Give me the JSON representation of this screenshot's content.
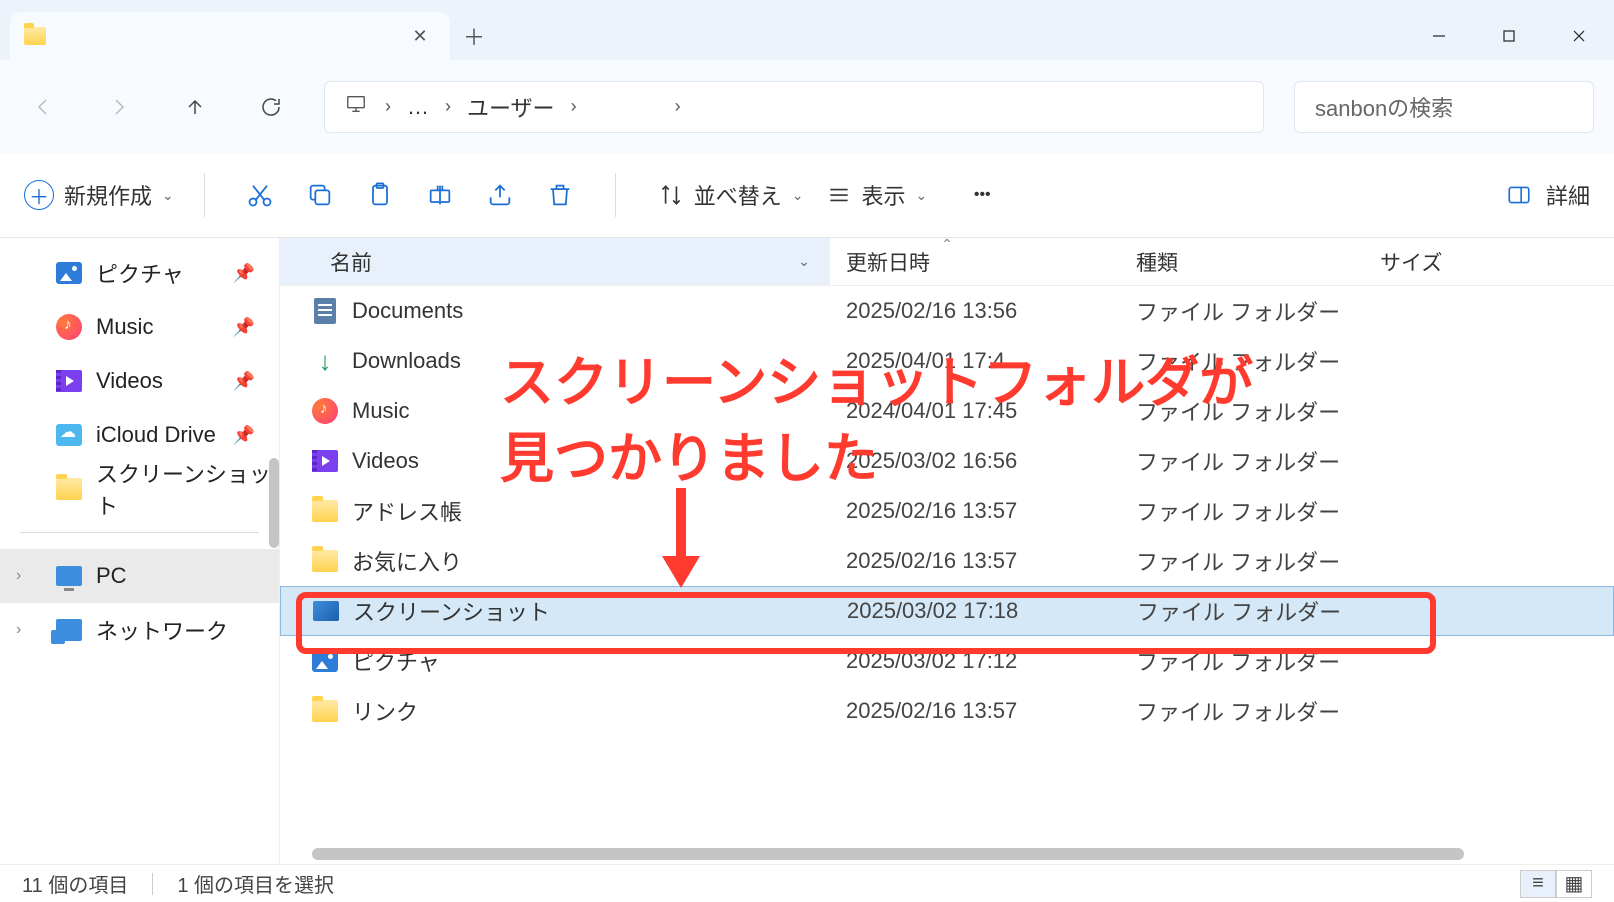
{
  "titlebar": {
    "tab_title": "　　　"
  },
  "nav": {
    "breadcrumb": {
      "dots": "…",
      "users": "ユーザー",
      "user_blurred": "　　　"
    },
    "search_placeholder": "sanbonの検索"
  },
  "toolbar": {
    "new": "新規作成",
    "sort": "並べ替え",
    "view": "表示",
    "details": "詳細"
  },
  "sidebar": {
    "items": [
      {
        "label": "ピクチャ",
        "icon": "picture",
        "pinned": true
      },
      {
        "label": "Music",
        "icon": "music",
        "pinned": true
      },
      {
        "label": "Videos",
        "icon": "video",
        "pinned": true
      },
      {
        "label": "iCloud Drive",
        "icon": "cloud",
        "pinned": true
      },
      {
        "label": "スクリーンショット",
        "icon": "folder",
        "pinned": false
      }
    ],
    "pc": "PC",
    "network": "ネットワーク"
  },
  "columns": {
    "name": "名前",
    "date": "更新日時",
    "type": "種類",
    "size": "サイズ"
  },
  "files": [
    {
      "name": "Documents",
      "date": "2025/02/16 13:56",
      "type": "ファイル フォルダー",
      "icon": "doc"
    },
    {
      "name": "Downloads",
      "date": "2025/04/01 17:4",
      "type": "ファイル フォルダー",
      "icon": "download"
    },
    {
      "name": "Music",
      "date": "2024/04/01 17:45",
      "type": "ファイル フォルダー",
      "icon": "music"
    },
    {
      "name": "Videos",
      "date": "2025/03/02 16:56",
      "type": "ファイル フォルダー",
      "icon": "video"
    },
    {
      "name": "アドレス帳",
      "date": "2025/02/16 13:57",
      "type": "ファイル フォルダー",
      "icon": "folder"
    },
    {
      "name": "お気に入り",
      "date": "2025/02/16 13:57",
      "type": "ファイル フォルダー",
      "icon": "folder"
    },
    {
      "name": "スクリーンショット",
      "date": "2025/03/02 17:18",
      "type": "ファイル フォルダー",
      "icon": "screenshot",
      "selected": true
    },
    {
      "name": "ピクチャ",
      "date": "2025/03/02 17:12",
      "type": "ファイル フォルダー",
      "icon": "picture"
    },
    {
      "name": "リンク",
      "date": "2025/02/16 13:57",
      "type": "ファイル フォルダー",
      "icon": "folder"
    }
  ],
  "status": {
    "count": "11 個の項目",
    "selected": "1 個の項目を選択"
  },
  "annotation": {
    "line1": "スクリーンショットフォルダが",
    "line2": "見つかりました"
  }
}
